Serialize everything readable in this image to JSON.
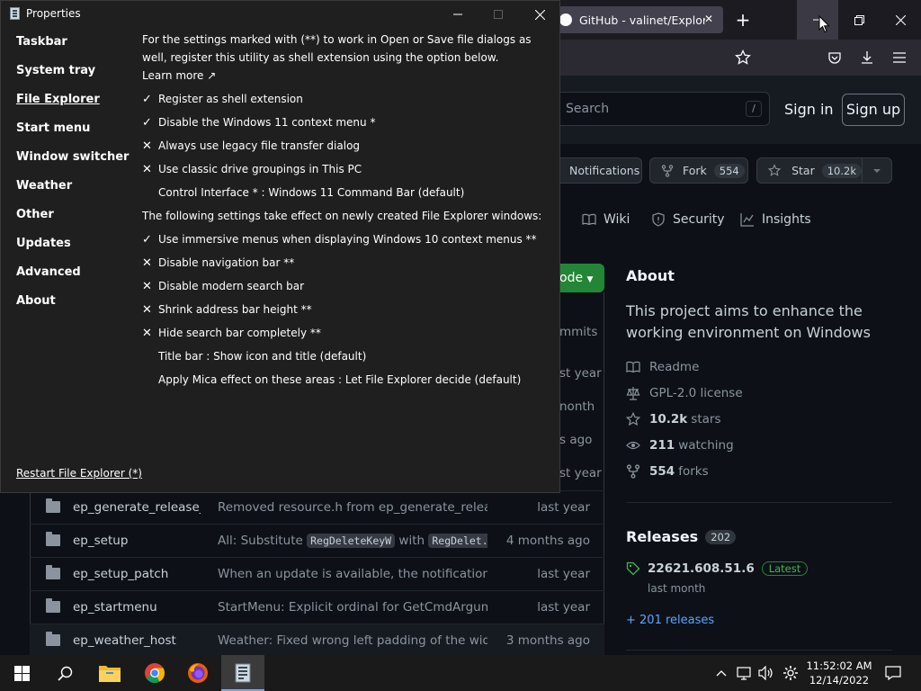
{
  "browser": {
    "tab_title": "GitHub - valinet/ExplorerPatcher",
    "tab_close": "✕",
    "new_tab": "+",
    "search_placeholder": "Search",
    "search_key": "/",
    "sign_in": "Sign in",
    "sign_up": "Sign up"
  },
  "repo": {
    "notifications": "Notifications",
    "fork_label": "Fork",
    "fork_count": "554",
    "star_label": "Star",
    "star_count": "10.2k",
    "tabs": [
      {
        "label": "Wiki"
      },
      {
        "label": "Security"
      },
      {
        "label": "Insights"
      }
    ],
    "code_label": "ode",
    "peek": {
      "commits": "mmits",
      "row1_age": "st year",
      "row2_age": "nonth",
      "row3_age": "s ago",
      "row4_age": "st year"
    },
    "files": [
      {
        "name": "ep_generate_release_...",
        "message": "Removed resource.h from ep_generate_release...",
        "age": "last year"
      },
      {
        "name": "ep_setup",
        "message_pre": "All: Substitute ",
        "kbd1": "RegDeleteKeyW",
        "message_mid": " with ",
        "kbd2": "RegDelet...",
        "age": "4 months ago"
      },
      {
        "name": "ep_setup_patch",
        "message": "When an update is available, the notification di...",
        "age": "last year"
      },
      {
        "name": "ep_startmenu",
        "message": "StartMenu: Explicit ordinal for GetCmdArgume...",
        "age": "last year"
      },
      {
        "name": "ep_weather_host",
        "message": "Weather: Fixed wrong left padding of the widget",
        "age": "3 months ago"
      }
    ],
    "about": {
      "title": "About",
      "description": "This project aims to enhance the working environment on Windows",
      "readme": "Readme",
      "license": "GPL-2.0 license",
      "stars_num": "10.2k",
      "stars_label": "stars",
      "watching_num": "211",
      "watching_label": "watching",
      "forks_num": "554",
      "forks_label": "forks"
    },
    "releases": {
      "title": "Releases",
      "count": "202",
      "latest_version": "22621.608.51.6",
      "latest_badge": "Latest",
      "latest_when": "last month",
      "more": "+ 201 releases"
    }
  },
  "dialog": {
    "title": "Properties",
    "nav": [
      {
        "label": "Taskbar",
        "active": false
      },
      {
        "label": "System tray",
        "active": false
      },
      {
        "label": "File Explorer",
        "active": true
      },
      {
        "label": "Start menu",
        "active": false
      },
      {
        "label": "Window switcher",
        "active": false
      },
      {
        "label": "Weather",
        "active": false
      },
      {
        "label": "Other",
        "active": false
      },
      {
        "label": "Updates",
        "active": false
      },
      {
        "label": "Advanced",
        "active": false
      },
      {
        "label": "About",
        "active": false
      }
    ],
    "restart_link": "Restart File Explorer (*)",
    "intro": "For the settings marked with (**) to work in Open or Save file dialogs as well, register this utility as shell extension using the option below.",
    "learn_more": "Learn more ↗",
    "options_group1": [
      {
        "mark": "✓",
        "label": "Register as shell extension"
      },
      {
        "mark": "✓",
        "label": "Disable the Windows 11 context menu *"
      },
      {
        "mark": "✕",
        "label": "Always use legacy file transfer dialog"
      },
      {
        "mark": "✕",
        "label": "Use classic drive groupings in This PC"
      },
      {
        "mark": "",
        "label": "Control Interface * : Windows 11 Command Bar (default)"
      }
    ],
    "section_note": "The following settings take effect on newly created File Explorer windows:",
    "options_group2": [
      {
        "mark": "✓",
        "label": "Use immersive menus when displaying Windows 10 context menus **"
      },
      {
        "mark": "✕",
        "label": "Disable navigation bar **"
      },
      {
        "mark": "✕",
        "label": "Disable modern search bar"
      },
      {
        "mark": "✕",
        "label": "Shrink address bar height **"
      },
      {
        "mark": "✕",
        "label": "Hide search bar completely **"
      },
      {
        "mark": "",
        "label": "Title bar : Show icon and title (default)"
      },
      {
        "mark": "",
        "label": "Apply Mica effect on these areas : Let File Explorer decide (default)"
      }
    ]
  },
  "taskbar": {
    "time": "11:52:02 AM",
    "date": "12/14/2022"
  }
}
